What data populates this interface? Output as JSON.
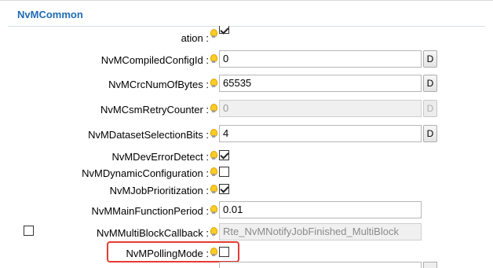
{
  "section": {
    "title": "NvMCommon"
  },
  "params": [
    {
      "label": "ation :",
      "type": "checkbox",
      "checked": true
    },
    {
      "label": "NvMCompiledConfigId :",
      "type": "text",
      "value": "0",
      "button": "D"
    },
    {
      "label": "NvMCrcNumOfBytes :",
      "type": "text",
      "value": "65535",
      "button": "D"
    },
    {
      "label": "NvMCsmRetryCounter :",
      "type": "text",
      "value": "0",
      "button": "D",
      "disabled": true
    },
    {
      "label": "NvMDatasetSelectionBits :",
      "type": "text",
      "value": "4",
      "button": "D"
    },
    {
      "label": "NvMDevErrorDetect :",
      "type": "checkbox",
      "checked": true
    },
    {
      "label": "NvMDynamicConfiguration :",
      "type": "checkbox",
      "checked": false
    },
    {
      "label": "NvMJobPrioritization :",
      "type": "checkbox",
      "checked": true
    },
    {
      "label": "NvMMainFunctionPeriod :",
      "type": "text",
      "value": "0.01"
    },
    {
      "label": "NvMMultiBlockCallback :",
      "type": "text",
      "value": "Rte_NvMNotifyJobFinished_MultiBlock",
      "disabled": true
    },
    {
      "label": "NvMPollingMode :",
      "type": "checkbox",
      "checked": false,
      "highlighted": true
    }
  ],
  "colors": {
    "title": "#1f6bb4",
    "highlight": "#e53b35",
    "bulb": "#ffcc22"
  },
  "icons": {
    "info": "lightbulb-icon"
  }
}
